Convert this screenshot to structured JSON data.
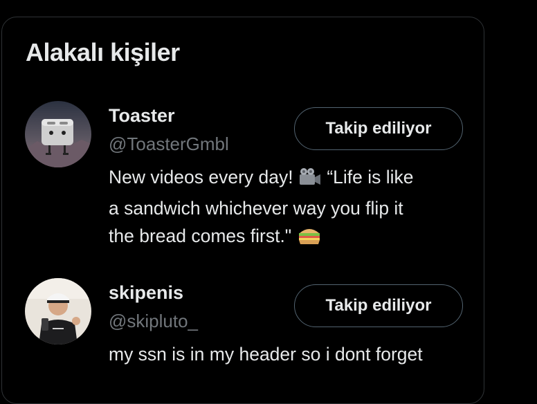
{
  "section": {
    "title": "Alakalı kişiler"
  },
  "people": [
    {
      "name": "Toaster",
      "handle": "@ToasterGmbl",
      "follow_label": "Takip ediliyor",
      "bio_line1_before_emoji": "New videos every day! ",
      "bio_line1_after_emoji": " “Life is like",
      "bio_line2": "a sandwich whichever way you flip it",
      "bio_line3": "the bread comes first.\" ",
      "bio_emojis": [
        "movie-camera-icon",
        "sandwich-icon"
      ]
    },
    {
      "name": "skipenis",
      "handle": "@skipluto_",
      "follow_label": "Takip ediliyor",
      "bio_line1": "my ssn is in my header so i dont forget"
    }
  ],
  "colors": {
    "background": "#000000",
    "border": "#2f3336",
    "text_primary": "#e7e9ea",
    "text_secondary": "#71767b",
    "button_border": "#536471"
  }
}
